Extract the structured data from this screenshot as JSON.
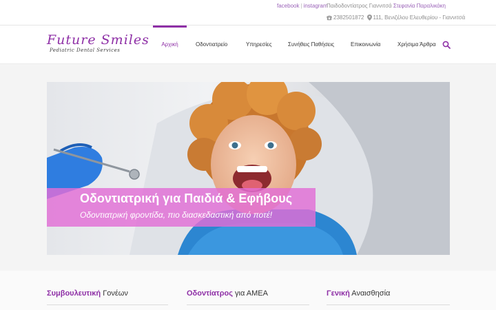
{
  "topbar": {
    "facebook": "facebook",
    "separator": "|",
    "instagram": "instagram",
    "doctor_prefix": "Παιδοδοντίατρος Γιαννιτσά",
    "doctor_name": "Στεφανία Παραλικάκη",
    "phone": "2382501872",
    "address": "111, Βενιζέλου Ελευθερίου - Γιαννιτσά"
  },
  "logo": {
    "line1": "Future Smiles",
    "line2": "Pediatric Dental Services"
  },
  "nav": {
    "items": [
      {
        "label": "Αρχική",
        "active": true
      },
      {
        "label": "Οδοντιατρείο",
        "active": false
      },
      {
        "label": "Υπηρεσίες",
        "active": false
      },
      {
        "label": "Συνήθεις Παθήσεις",
        "active": false
      },
      {
        "label": "Επικοινωνία",
        "active": false
      },
      {
        "label": "Χρήσιμα Άρθρα",
        "active": false
      }
    ],
    "search_icon": "search-icon"
  },
  "hero": {
    "title": "Οδοντιατρική για Παιδιά & Εφήβους",
    "subtitle": "Οδοντιατρική φροντίδα, πιο διασκεδαστική από ποτέ!"
  },
  "columns": [
    {
      "bold": "Συμβουλευτική",
      "rest": " Γονέων"
    },
    {
      "bold": "Οδοντίατρος",
      "rest": " για ΑΜΕΑ"
    },
    {
      "bold": "Γενική",
      "rest": " Αναισθησία"
    }
  ],
  "colors": {
    "accent": "#8e2fa6",
    "banner": "#e26ed6",
    "link": "#9a62b8"
  }
}
